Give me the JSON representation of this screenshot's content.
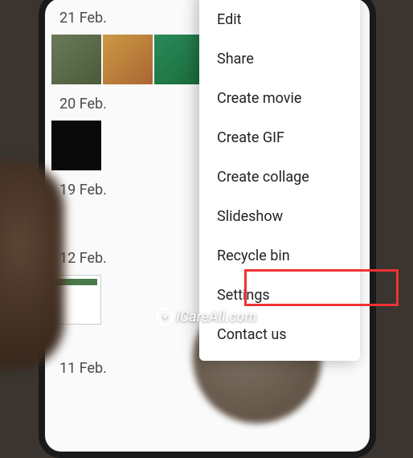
{
  "dates": {
    "d0": "21 Feb.",
    "d1": "20 Feb.",
    "d2": "19 Feb.",
    "d3": "12 Feb.",
    "d4": "11 Feb."
  },
  "menu": {
    "edit": "Edit",
    "share": "Share",
    "create_movie": "Create movie",
    "create_gif": "Create GIF",
    "create_collage": "Create collage",
    "slideshow": "Slideshow",
    "recycle_bin": "Recycle bin",
    "settings": "Settings",
    "contact": "Contact us"
  },
  "watermark": "iCareAll.com",
  "highlight_target": "recycle_bin"
}
